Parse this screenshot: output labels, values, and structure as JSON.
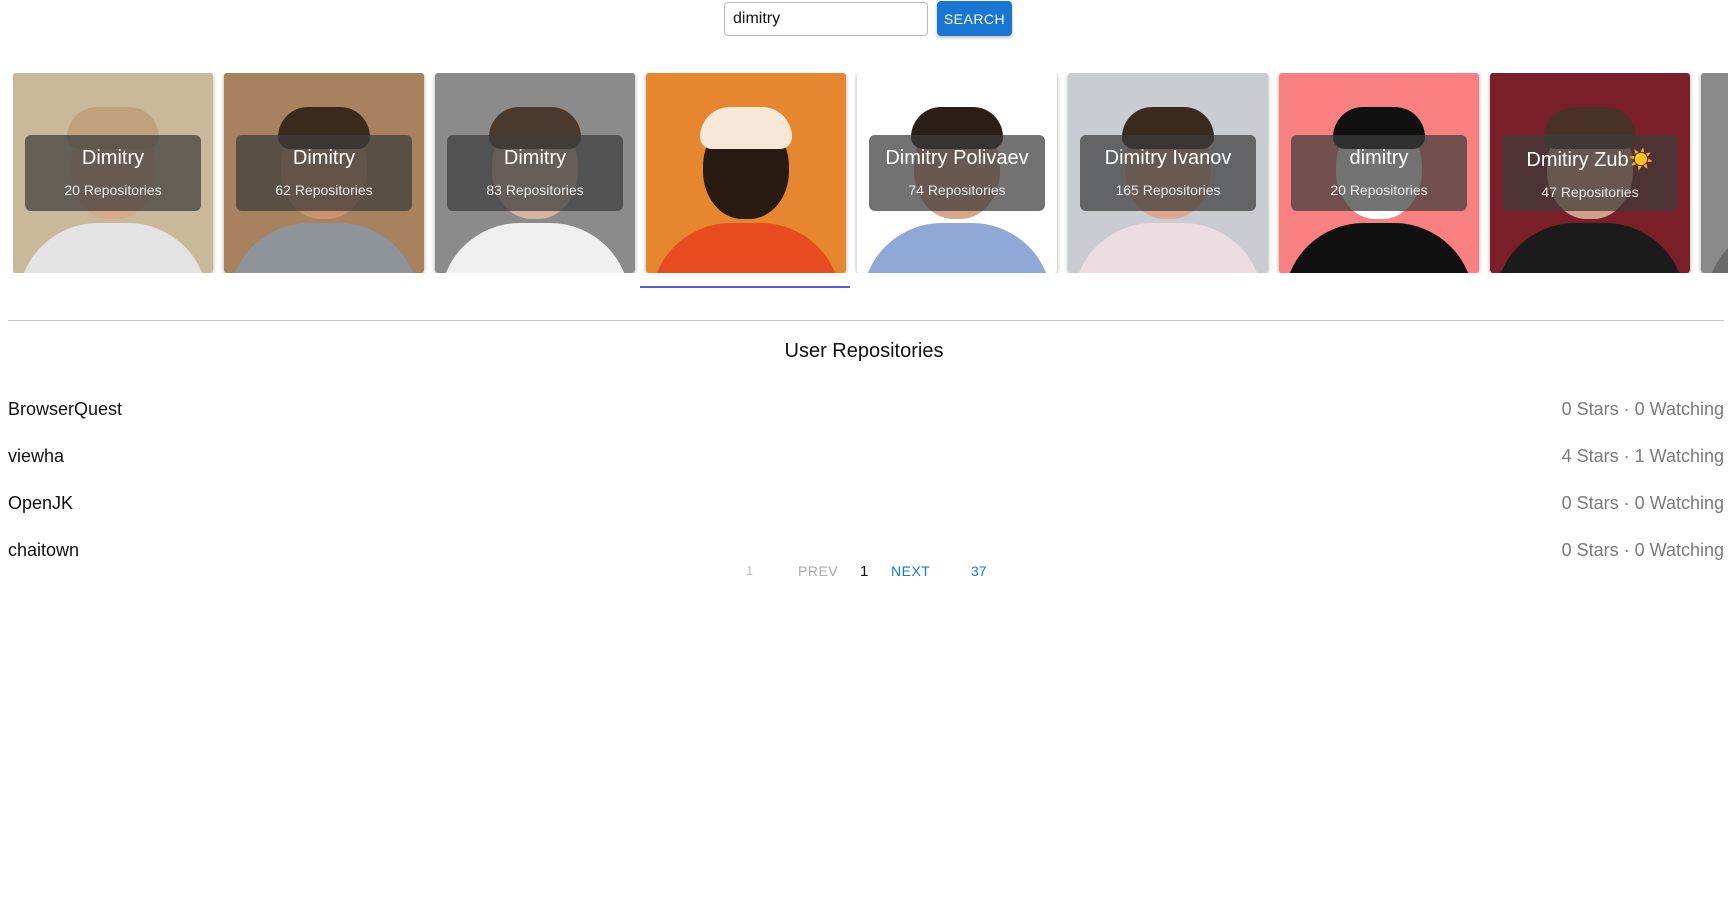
{
  "search": {
    "value": "dimitry",
    "button_label": "SEARCH"
  },
  "users": [
    {
      "name": "Dimitry",
      "repos": "20 Repositories",
      "bg": "#c9b99a",
      "skin": "#d6a88c",
      "hair": "#bfa27c",
      "shirt": "#e3e3e3"
    },
    {
      "name": "Dimitry",
      "repos": "62 Repositories",
      "bg": "#a8825e",
      "skin": "#c9936f",
      "hair": "#3a2a1d",
      "shirt": "#8e949a"
    },
    {
      "name": "Dimitry",
      "repos": "83 Repositories",
      "bg": "#8b8b8b",
      "skin": "#d4b3a1",
      "hair": "#4a3a2e",
      "shirt": "#efefef"
    },
    {
      "name": "",
      "repos": "",
      "bg": "#e6862f",
      "skin": "#2a1b12",
      "hair": "#f6e7d8",
      "shirt": "#e84c1e"
    },
    {
      "name": "Dimitry Polivaev",
      "repos": "74 Repositories",
      "bg": "#ffffff",
      "skin": "#d7a58a",
      "hair": "#2b1e17",
      "shirt": "#8fa8d6"
    },
    {
      "name": "Dimitry Ivanov",
      "repos": "165 Repositories",
      "bg": "#c9ccd1",
      "skin": "#dca88f",
      "hair": "#3c2a1f",
      "shirt": "#eedce3"
    },
    {
      "name": "dimitry",
      "repos": "20 Repositories",
      "bg": "#f98080",
      "skin": "#ffffff",
      "hair": "#111111",
      "shirt": "#111111"
    },
    {
      "name": "Dmitiry Zub☀️",
      "repos": "47 Repositories",
      "bg": "#7a1f27",
      "skin": "#d2a08a",
      "hair": "#4a3125",
      "shirt": "#1b1b1b"
    },
    {
      "name": "",
      "repos": "",
      "bg": "#8a8a8a",
      "skin": "#8a8a8a",
      "hair": "#6a6a6a",
      "shirt": "#6a6a6a"
    }
  ],
  "section_title": "User Repositories",
  "repositories": [
    {
      "name": "BrowserQuest",
      "stats": "0 Stars · 0 Watching"
    },
    {
      "name": "viewha",
      "stats": "4 Stars · 1 Watching"
    },
    {
      "name": "OpenJK",
      "stats": "0 Stars · 0 Watching"
    },
    {
      "name": "chaitown",
      "stats": "0 Stars · 0 Watching"
    }
  ],
  "pagination": {
    "first": "1",
    "prev": "PREV",
    "current": "1",
    "next": "NEXT",
    "last": "37"
  }
}
